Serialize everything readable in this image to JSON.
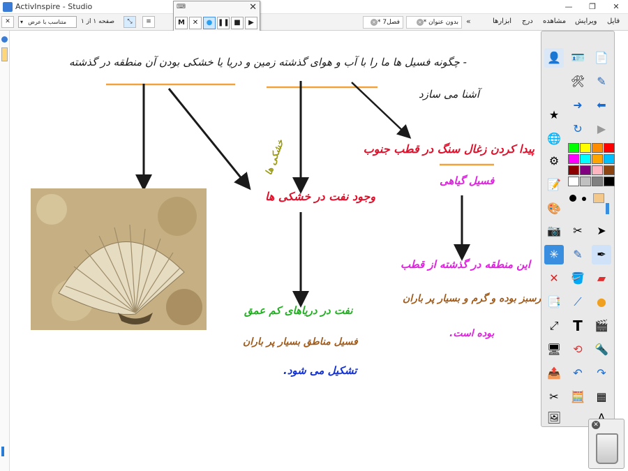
{
  "window": {
    "title": "ActivInspire - Studio",
    "minimize_glyph": "—",
    "maximize_glyph": "❐",
    "close_glyph": "✕"
  },
  "menu": {
    "items": [
      "فایل",
      "ویرایش",
      "مشاهده",
      "درج",
      "ابزارها"
    ],
    "overflow": "»"
  },
  "tabs": [
    {
      "label": "بدون عنوان *",
      "close": "×"
    },
    {
      "label": "فصل7 *",
      "close": "×"
    }
  ],
  "tab_scroll": "«",
  "page_nav": {
    "page_label": "صفحه ۱ از ۱",
    "zoom_value": "متناسب با عرض",
    "zoom_caret": "▾",
    "fit_glyph": "⤡",
    "collapse_glyph": "✕"
  },
  "recorder": {
    "title_glyph": "⌨",
    "close_glyph": "✕",
    "buttons": [
      "M",
      "✕",
      "●",
      "❚❚",
      "■",
      "▶"
    ]
  },
  "flipchart": {
    "heading_1": "چگونه فسیل ها ما را با آب و هوای گذشته زمین و دریا یا خشکی بودن آن منطقه در گذشته",
    "heading_1_connector": "و",
    "heading_1_dash": "-",
    "heading_2": "آشنا می سازد",
    "node_coal_fossil": "پیدا کردن زغال سنگ در قطب جنوب",
    "node_plant_fossil": "فسیل گیاهی",
    "node_oil": "وجود نفت در خشکی ها",
    "oil_place": "خشکی ها",
    "explain_polar_1": "این منطقه در گذشته از قطب",
    "explain_polar_2": "سرسبز بوده و گرم و بسیار پر باران",
    "explain_polar_3": "بوده است.",
    "oil_sea_1": "نفت در دریاهای کم عمق",
    "oil_sea_2": "فسیل مناطق بسیار پر باران",
    "oil_sea_3": "تشکیل می شود.",
    "fossil_image_alt": "shell fossil"
  },
  "colors": {
    "ink_black": "#1a1a1a",
    "ink_green": "#22b022",
    "ink_olive": "#9a9a10",
    "ink_red": "#e0102a",
    "ink_blue": "#1030d8",
    "ink_magenta": "#e020e0",
    "ink_brown": "#a05a1a",
    "underline_orange": "#f2a23a"
  },
  "toolbox": {
    "palette": [
      "#00ff00",
      "#ffff00",
      "#ff8c00",
      "#ff0000",
      "#ff00ff",
      "#00ffff",
      "#ffa500",
      "#00bfff",
      "#8b0000",
      "#800080",
      "#ffb6c1",
      "#8b4513",
      "#ffffff",
      "#c0c0c0",
      "#808080",
      "#000000"
    ]
  }
}
